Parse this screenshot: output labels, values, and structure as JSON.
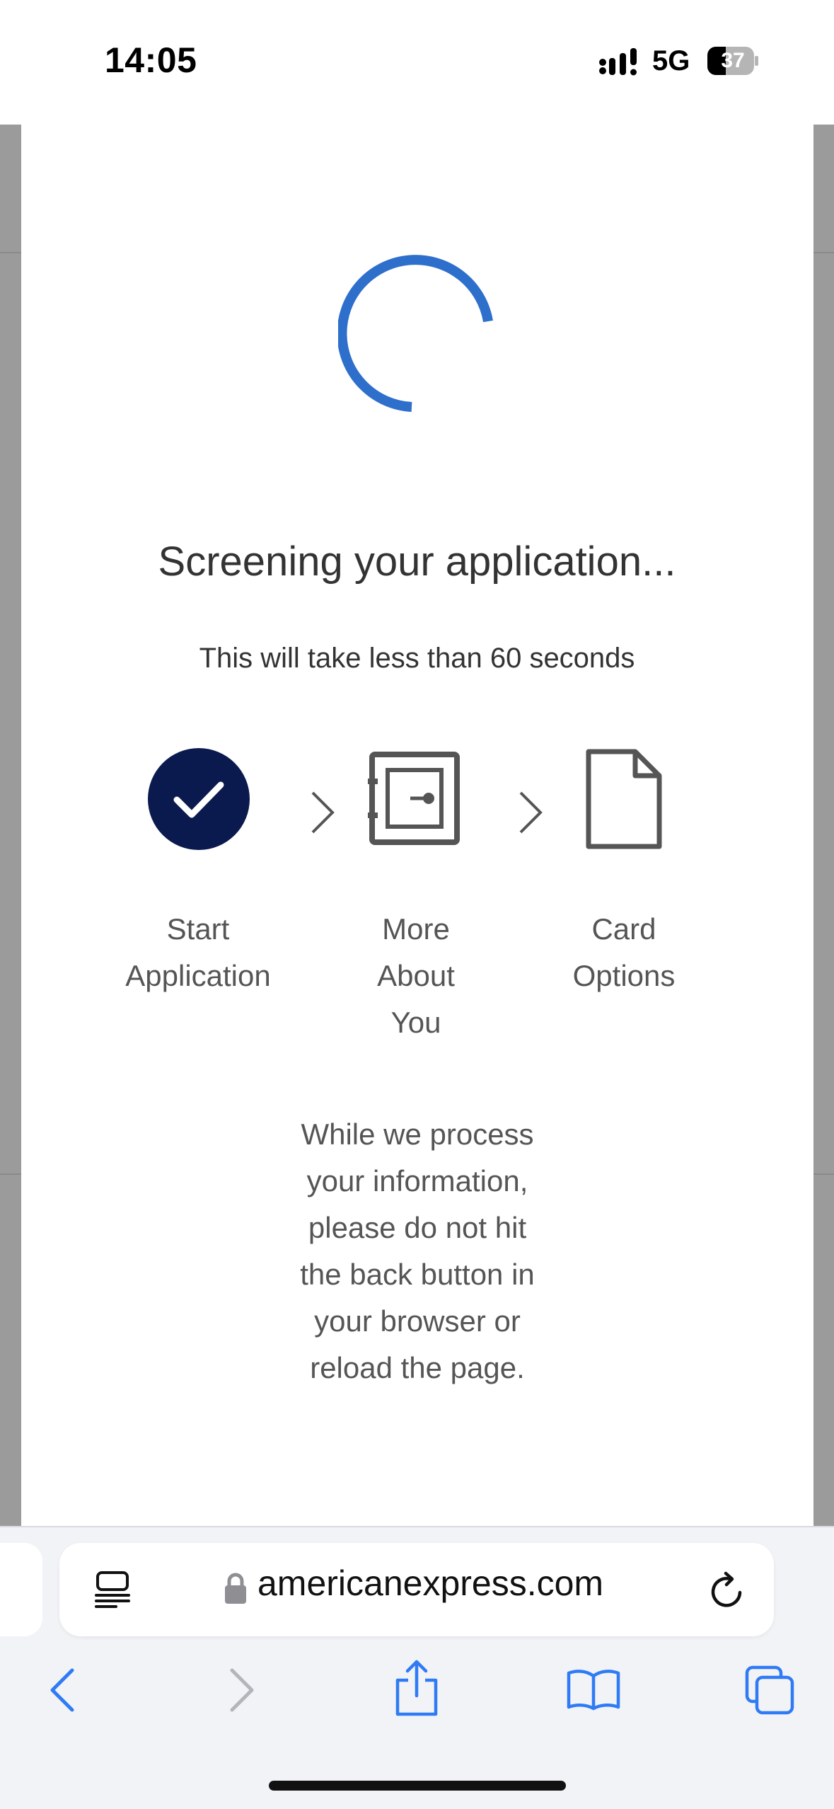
{
  "status_bar": {
    "time": "14:05",
    "network": "5G",
    "battery": "37"
  },
  "loading": {
    "title": "Screening your application...",
    "subtitle": "This will take less than 60 seconds"
  },
  "steps": [
    {
      "line1": "Start",
      "line2": "Application",
      "line3": "",
      "state": "complete",
      "icon": "check-circle-icon"
    },
    {
      "line1": "More",
      "line2": "About",
      "line3": "You",
      "state": "current",
      "icon": "safe-icon"
    },
    {
      "line1": "Card",
      "line2": "Options",
      "line3": "",
      "state": "upcoming",
      "icon": "document-icon"
    }
  ],
  "notice": {
    "line1": "While we process",
    "line2": "your information,",
    "line3": "please do not hit",
    "line4": "the back button in",
    "line5": "your browser or",
    "line6": "reload the page."
  },
  "browser": {
    "url": "americanexpress.com"
  },
  "colors": {
    "spinner": "#2e6fcb",
    "check_fill": "#0a1a4f",
    "icon_gray": "#555555",
    "toolbar_blue": "#2f7bf5"
  }
}
